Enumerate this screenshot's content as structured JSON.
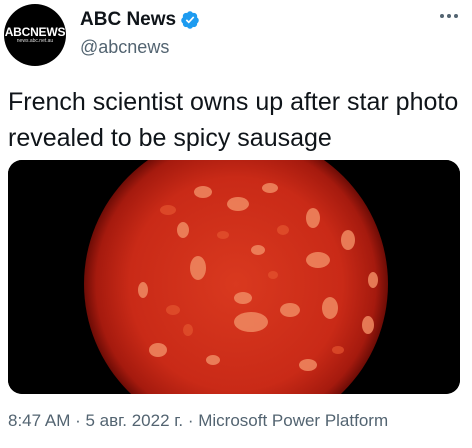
{
  "account": {
    "display_name": "ABC News",
    "handle": "@abcnews",
    "avatar_logo": "ABCNEWS",
    "avatar_sub": "news.abc.net.au",
    "verified_icon": "verified-badge-icon"
  },
  "tweet": {
    "text": "French scientist owns up after star photo revealed to be spicy sausage"
  },
  "meta": {
    "time": "8:47 AM",
    "separator1": " · ",
    "date": "5 авг. 2022 г.",
    "separator2": " · ",
    "source": "Microsoft Power Platform"
  },
  "colors": {
    "verified_blue": "#1d9bf0",
    "muted_text": "#536471",
    "sausage_red": "#d3321c"
  }
}
